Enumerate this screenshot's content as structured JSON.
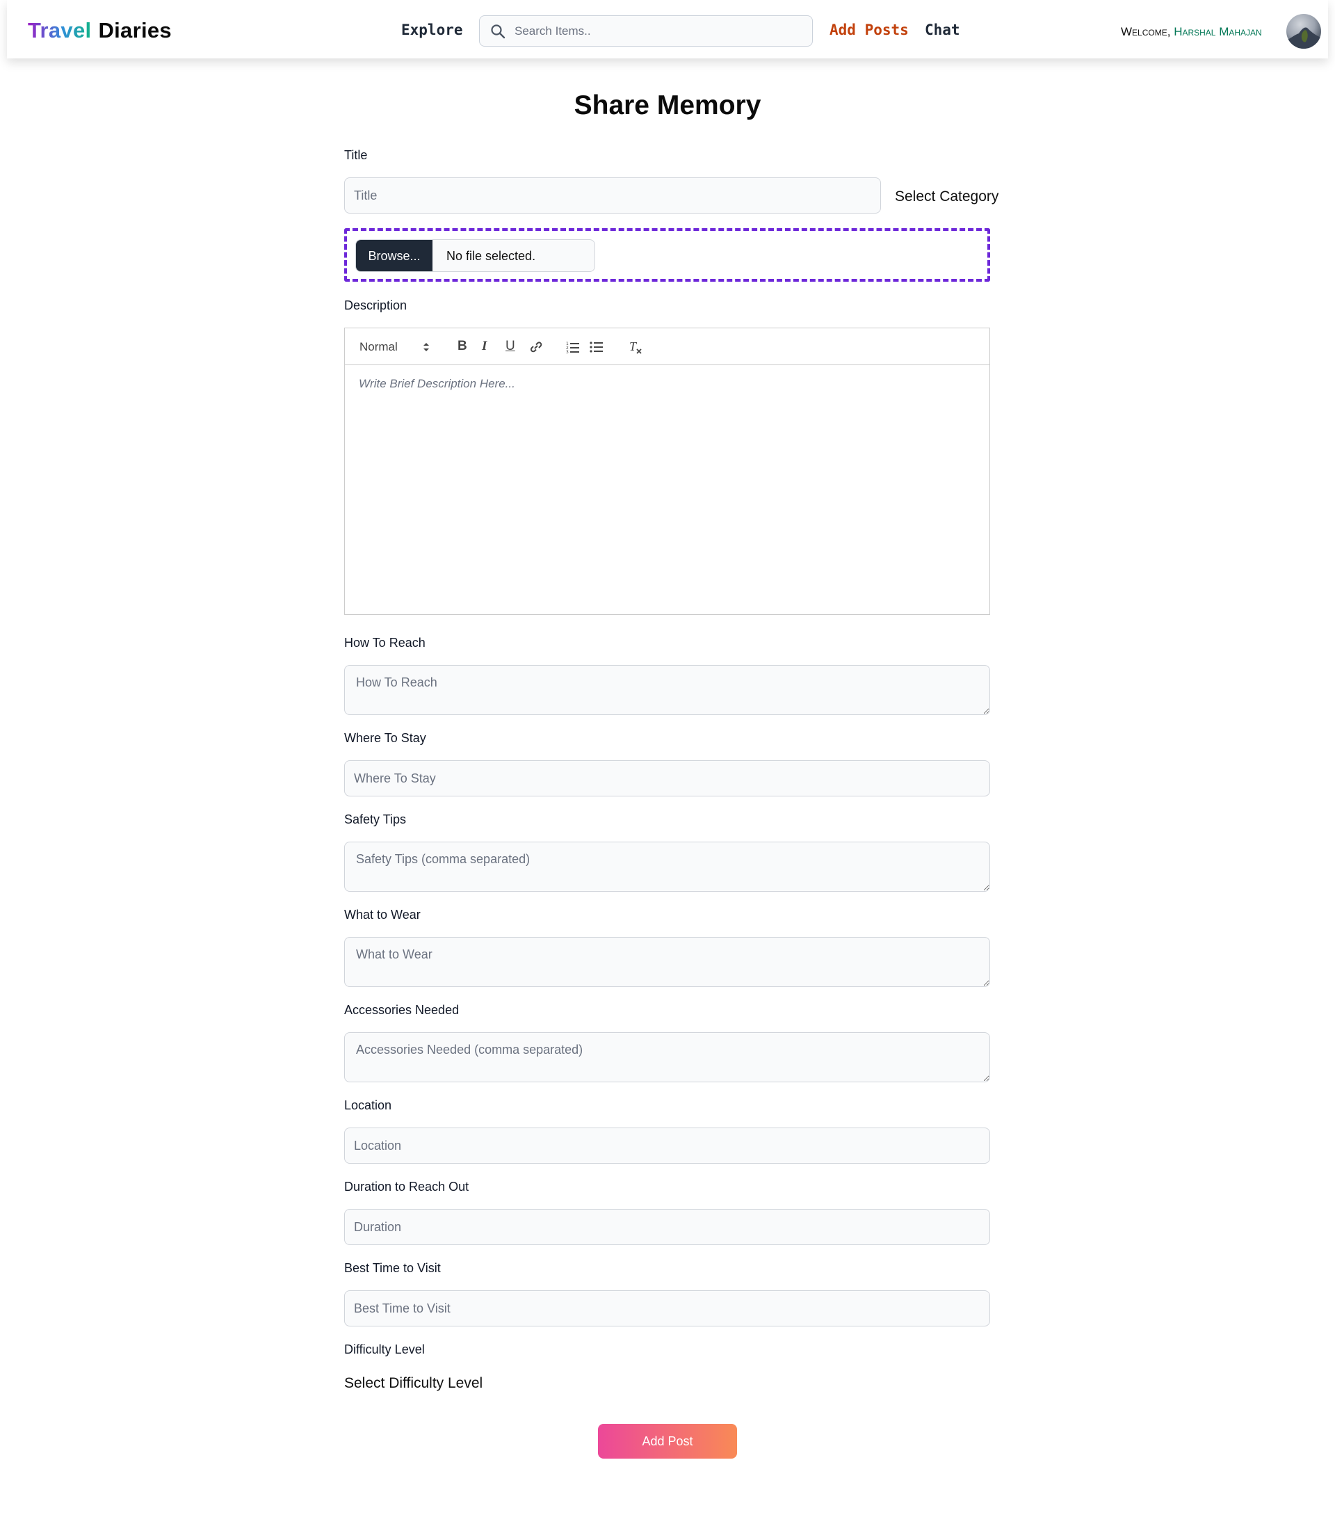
{
  "navbar": {
    "brand_part1": "Travel",
    "brand_part2": "Diaries",
    "explore": "Explore",
    "search_placeholder": "Search Items..",
    "add_posts": "Add Posts",
    "chat": "Chat",
    "welcome_prefix": "Welcome,",
    "username": "Harshal Mahajan"
  },
  "page_title": "Share Memory",
  "form": {
    "title": {
      "label": "Title",
      "placeholder": "Title"
    },
    "select_category": "Select Category",
    "file": {
      "button": "Browse...",
      "status": "No file selected."
    },
    "description": {
      "label": "Description",
      "format": "Normal",
      "placeholder": "Write Brief Description Here..."
    },
    "how_to_reach": {
      "label": "How To Reach",
      "placeholder": "How To Reach"
    },
    "where_to_stay": {
      "label": "Where To Stay",
      "placeholder": "Where To Stay"
    },
    "safety_tips": {
      "label": "Safety Tips",
      "placeholder": "Safety Tips (comma separated)"
    },
    "what_to_wear": {
      "label": "What to Wear",
      "placeholder": "What to Wear"
    },
    "accessories": {
      "label": "Accessories Needed",
      "placeholder": "Accessories Needed (comma separated)"
    },
    "location": {
      "label": "Location",
      "placeholder": "Location"
    },
    "duration": {
      "label": "Duration to Reach Out",
      "placeholder": "Duration"
    },
    "best_time": {
      "label": "Best Time to Visit",
      "placeholder": "Best Time to Visit"
    },
    "difficulty": {
      "label": "Difficulty Level",
      "select": "Select Difficulty Level"
    },
    "submit": "Add Post"
  },
  "colors": {
    "accent_purple": "#6d28d9",
    "nav_add_posts": "#c2410c",
    "username_green": "#047857",
    "button_gradient_start": "#ec4899",
    "button_gradient_end": "#f98a56"
  },
  "icons": [
    "search-icon",
    "bold-icon",
    "italic-icon",
    "underline-icon",
    "link-icon",
    "ordered-list-icon",
    "bullet-list-icon",
    "clear-format-icon",
    "avatar"
  ]
}
